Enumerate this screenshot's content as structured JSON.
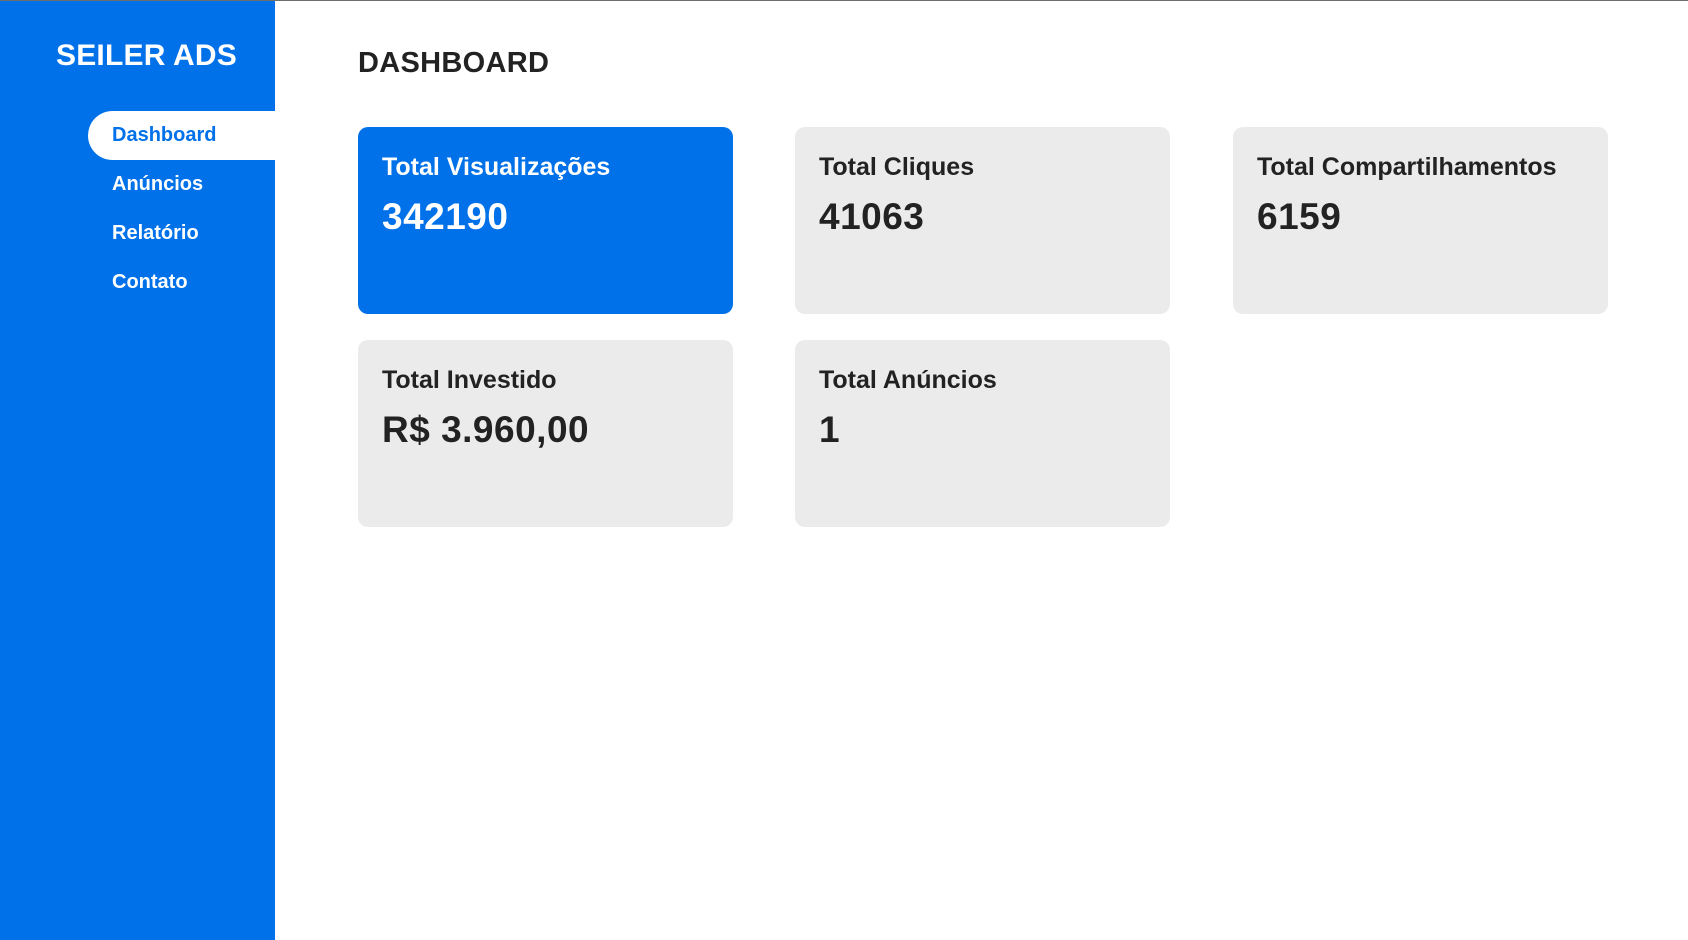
{
  "sidebar": {
    "brand": "SEILER ADS",
    "items": [
      {
        "label": "Dashboard",
        "active": true
      },
      {
        "label": "Anúncios",
        "active": false
      },
      {
        "label": "Relatório",
        "active": false
      },
      {
        "label": "Contato",
        "active": false
      }
    ]
  },
  "main": {
    "title": "DASHBOARD",
    "cards": [
      {
        "label": "Total Visualizações",
        "value": "342190",
        "highlight": true
      },
      {
        "label": "Total Cliques",
        "value": "41063",
        "highlight": false
      },
      {
        "label": "Total Compartilhamentos",
        "value": "6159",
        "highlight": false
      },
      {
        "label": "Total Investido",
        "value": "R$ 3.960,00",
        "highlight": false
      },
      {
        "label": "Total Anúncios",
        "value": "1",
        "highlight": false
      }
    ]
  },
  "colors": {
    "primary": "#0071e8",
    "card_bg": "#ebebeb",
    "text": "#222222"
  }
}
